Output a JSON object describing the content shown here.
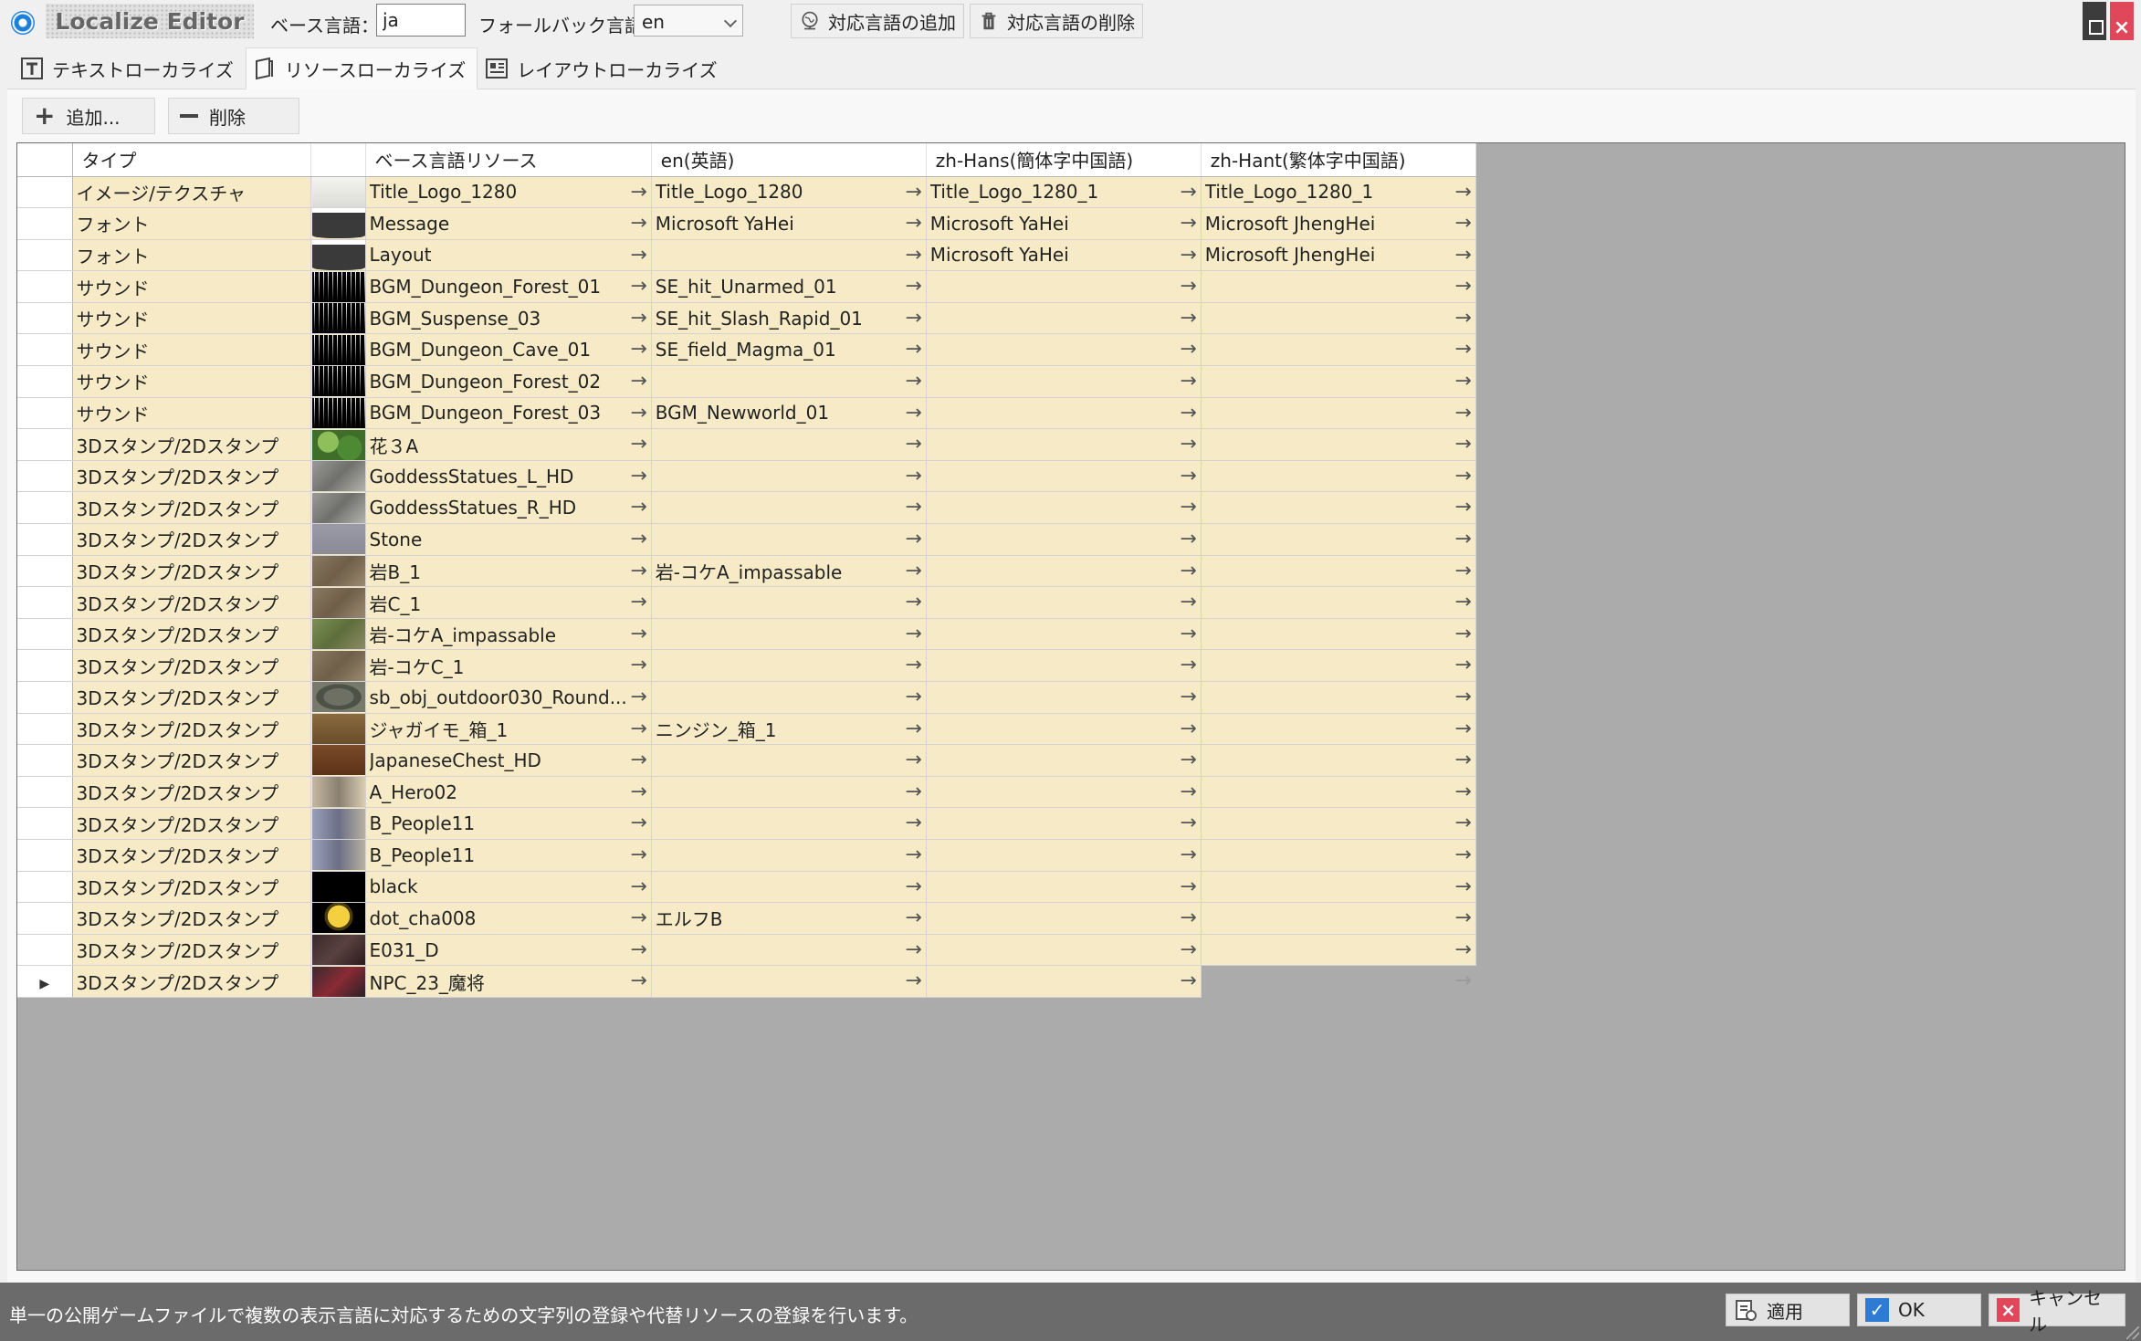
{
  "window": {
    "app_title": "Localize Editor",
    "base_lang_label": "ベース言語：",
    "base_lang_value": "ja",
    "fallback_label": "フォールバック言語：",
    "fallback_value": "en",
    "add_lang_button": "対応言語の追加",
    "remove_lang_button": "対応言語の削除"
  },
  "tabs": [
    {
      "label": "テキストローカライズ",
      "icon": "text-icon"
    },
    {
      "label": "リソースローカライズ",
      "icon": "page-icon",
      "active": true
    },
    {
      "label": "レイアウトローカライズ",
      "icon": "layout-icon"
    }
  ],
  "toolbar": {
    "add_label": "追加...",
    "delete_label": "削除"
  },
  "grid": {
    "columns": [
      "タイプ",
      "",
      "ベース言語リソース",
      "en(英語)",
      "zh-Hans(簡体字中国語)",
      "zh-Hant(繁体字中国語)"
    ],
    "rows": [
      {
        "type": "イメージ/テクスチャ",
        "thumb": "logo",
        "base": "Title_Logo_1280",
        "en": "Title_Logo_1280",
        "hans": "Title_Logo_1280_1",
        "hant": "Title_Logo_1280_1"
      },
      {
        "type": "フォント",
        "thumb": "font",
        "base": "Message",
        "en": "Microsoft YaHei",
        "hans": "Microsoft YaHei",
        "hant": "Microsoft JhengHei"
      },
      {
        "type": "フォント",
        "thumb": "font",
        "base": "Layout",
        "en": "",
        "hans": "Microsoft YaHei",
        "hant": "Microsoft JhengHei"
      },
      {
        "type": "サウンド",
        "thumb": "wave",
        "base": "BGM_Dungeon_Forest_01",
        "en": "SE_hit_Unarmed_01",
        "hans": "",
        "hant": ""
      },
      {
        "type": "サウンド",
        "thumb": "wave",
        "base": "BGM_Suspense_03",
        "en": "SE_hit_Slash_Rapid_01",
        "hans": "",
        "hant": ""
      },
      {
        "type": "サウンド",
        "thumb": "wave",
        "base": "BGM_Dungeon_Cave_01",
        "en": "SE_field_Magma_01",
        "hans": "",
        "hant": ""
      },
      {
        "type": "サウンド",
        "thumb": "wave",
        "base": "BGM_Dungeon_Forest_02",
        "en": "",
        "hans": "",
        "hant": ""
      },
      {
        "type": "サウンド",
        "thumb": "wave",
        "base": "BGM_Dungeon_Forest_03",
        "en": "BGM_Newworld_01",
        "hans": "",
        "hant": ""
      },
      {
        "type": "3Dスタンプ/2Dスタンプ",
        "thumb": "plant",
        "base": "花３A",
        "en": "",
        "hans": "",
        "hant": ""
      },
      {
        "type": "3Dスタンプ/2Dスタンプ",
        "thumb": "statue",
        "base": "GoddessStatues_L_HD",
        "en": "",
        "hans": "",
        "hant": ""
      },
      {
        "type": "3Dスタンプ/2Dスタンプ",
        "thumb": "statue",
        "base": "GoddessStatues_R_HD",
        "en": "",
        "hans": "",
        "hant": ""
      },
      {
        "type": "3Dスタンプ/2Dスタンプ",
        "thumb": "stone",
        "base": "Stone",
        "en": "",
        "hans": "",
        "hant": ""
      },
      {
        "type": "3Dスタンプ/2Dスタンプ",
        "thumb": "rock",
        "base": "岩B_1",
        "en": "岩-コケA_impassable",
        "hans": "",
        "hant": ""
      },
      {
        "type": "3Dスタンプ/2Dスタンプ",
        "thumb": "rock",
        "base": "岩C_1",
        "en": "",
        "hans": "",
        "hant": ""
      },
      {
        "type": "3Dスタンプ/2Dスタンプ",
        "thumb": "moss",
        "base": "岩-コケA_impassable",
        "en": "",
        "hans": "",
        "hant": ""
      },
      {
        "type": "3Dスタンプ/2Dスタンプ",
        "thumb": "rock",
        "base": "岩-コケC_1",
        "en": "",
        "hans": "",
        "hant": ""
      },
      {
        "type": "3Dスタンプ/2Dスタンプ",
        "thumb": "round",
        "base": "sb_obj_outdoor030_Round...",
        "en": "",
        "hans": "",
        "hant": ""
      },
      {
        "type": "3Dスタンプ/2Dスタンプ",
        "thumb": "box",
        "base": "ジャガイモ_箱_1",
        "en": "ニンジン_箱_1",
        "hans": "",
        "hant": ""
      },
      {
        "type": "3Dスタンプ/2Dスタンプ",
        "thumb": "chest",
        "base": "JapaneseChest_HD",
        "en": "",
        "hans": "",
        "hant": ""
      },
      {
        "type": "3Dスタンプ/2Dスタンプ",
        "thumb": "hero",
        "base": "A_Hero02",
        "en": "",
        "hans": "",
        "hant": ""
      },
      {
        "type": "3Dスタンプ/2Dスタンプ",
        "thumb": "people",
        "base": "B_People11",
        "en": "",
        "hans": "",
        "hant": ""
      },
      {
        "type": "3Dスタンプ/2Dスタンプ",
        "thumb": "people",
        "base": "B_People11",
        "en": "",
        "hans": "",
        "hant": ""
      },
      {
        "type": "3Dスタンプ/2Dスタンプ",
        "thumb": "black",
        "base": "black",
        "en": "",
        "hans": "",
        "hant": ""
      },
      {
        "type": "3Dスタンプ/2Dスタンプ",
        "thumb": "dot",
        "base": "dot_cha008",
        "en": "エルフB",
        "hans": "",
        "hant": ""
      },
      {
        "type": "3Dスタンプ/2Dスタンプ",
        "thumb": "dark",
        "base": "E031_D",
        "en": "",
        "hans": "",
        "hant": ""
      },
      {
        "type": "3Dスタンプ/2Dスタンプ",
        "thumb": "npc",
        "base": "NPC_23_魔将",
        "en": "",
        "hans": "",
        "hant": "",
        "current": true,
        "hant_empty": true
      }
    ]
  },
  "status": {
    "message": "単一の公開ゲームファイルで複数の表示言語に対応するための文字列の登録や代替リソースの登録を行います。",
    "apply_label": "適用",
    "ok_label": "OK",
    "cancel_label": "キャンセル"
  },
  "colors": {
    "cell_bg": "#f6ebc6",
    "grid_bg": "#ababab",
    "status_bg": "#6b6b6b",
    "accent": "#2e7bd3",
    "close": "#e0475a"
  }
}
